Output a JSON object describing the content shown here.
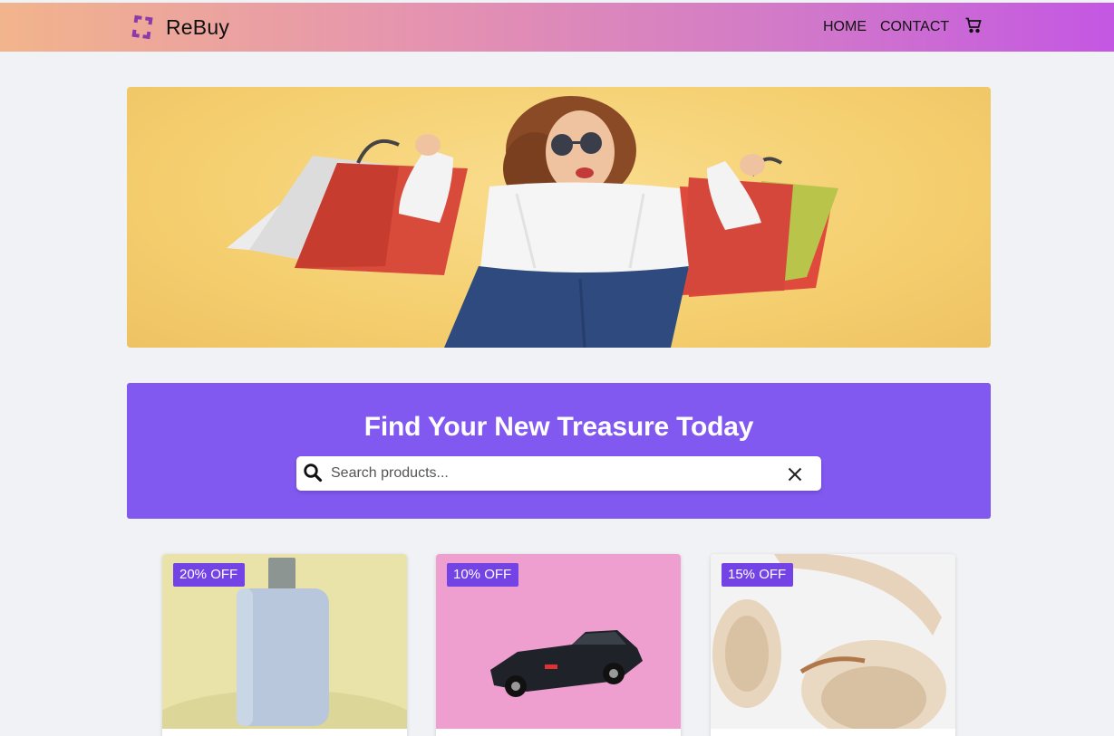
{
  "brand": {
    "name": "ReBuy",
    "logo_icon": "rebuy-logo-icon",
    "logo_color": "#8b3aa8"
  },
  "nav": {
    "home": "HOME",
    "contact": "CONTACT",
    "cart_icon": "cart-icon"
  },
  "hero": {
    "image": "woman-with-shopping-bags"
  },
  "search": {
    "title": "Find Your New Treasure Today",
    "placeholder": "Search products...",
    "value": "",
    "icon": "search-icon",
    "clear_icon": "close-icon"
  },
  "products": [
    {
      "discount": "20% OFF",
      "image": "perfume-bottle"
    },
    {
      "discount": "10% OFF",
      "image": "toy-car"
    },
    {
      "discount": "15% OFF",
      "image": "headphones"
    }
  ],
  "colors": {
    "accent": "#8259f0",
    "badge": "#7443e6",
    "background": "#f1f2f5"
  }
}
